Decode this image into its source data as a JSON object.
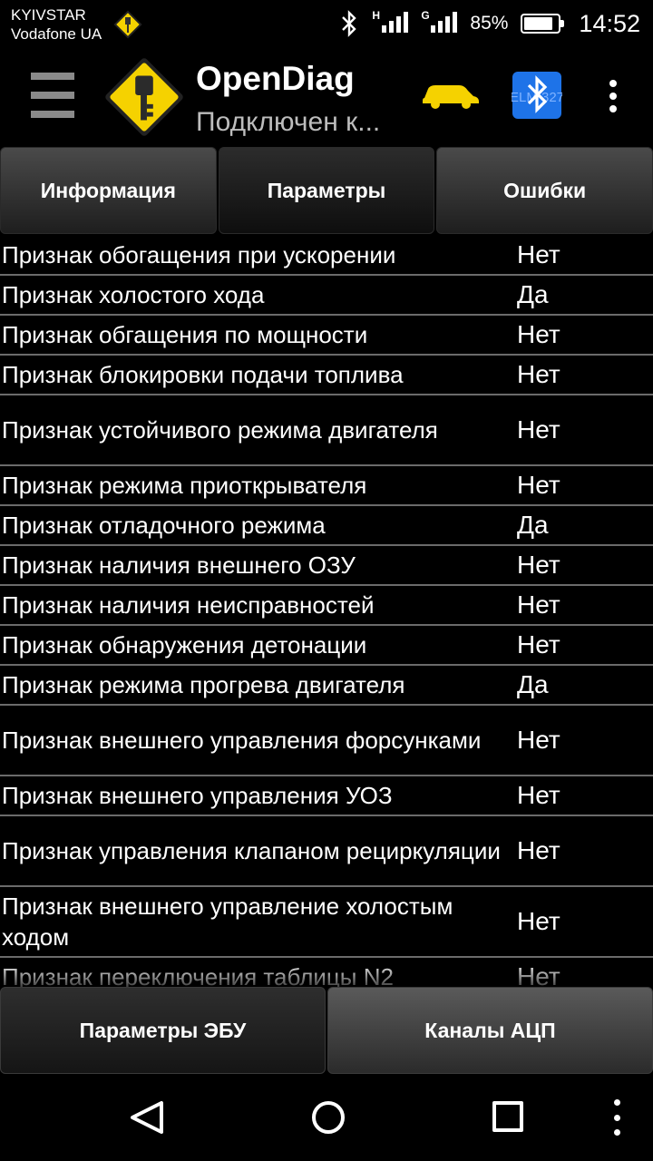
{
  "status_bar": {
    "carrier_1": "KYIVSTAR",
    "carrier_2": "Vodafone UA",
    "signal_1_label": "H",
    "signal_2_label": "G",
    "battery_percent": "85%",
    "battery_level": 0.85,
    "time": "14:52"
  },
  "app_bar": {
    "title": "OpenDiag",
    "subtitle": "Подключен к...",
    "bt_label": "ELM 327",
    "car_color": "#f5d200",
    "bt_color": "#1e73e8"
  },
  "tabs": [
    {
      "label": "Информация",
      "active": false
    },
    {
      "label": "Параметры",
      "active": true
    },
    {
      "label": "Ошибки",
      "active": false
    }
  ],
  "parameters": [
    {
      "name": "Признак обогащения при ускорении",
      "value": "Нет"
    },
    {
      "name": "Признак холостого хода",
      "value": "Да"
    },
    {
      "name": "Признак обгащения по мощности",
      "value": "Нет"
    },
    {
      "name": "Признак блокировки подачи топлива",
      "value": "Нет"
    },
    {
      "name": "Признак устойчивого режима двигателя",
      "value": "Нет"
    },
    {
      "name": "Признак режима приоткрывателя",
      "value": "Нет"
    },
    {
      "name": "Признак отладочного режима",
      "value": "Да"
    },
    {
      "name": "Признак наличия внешнего ОЗУ",
      "value": "Нет"
    },
    {
      "name": "Признак наличия неисправностей",
      "value": "Нет"
    },
    {
      "name": "Признак обнаружения детонации",
      "value": "Нет"
    },
    {
      "name": "Признак режима прогрева двигателя",
      "value": "Да"
    },
    {
      "name": "Признак внешнего управления форсунками",
      "value": "Нет"
    },
    {
      "name": "Признак внешнего управления УОЗ",
      "value": "Нет"
    },
    {
      "name": "Признак управления клапаном рециркуляции",
      "value": "Нет"
    },
    {
      "name": "Признак внешнего управление холостым ходом",
      "value": "Нет"
    },
    {
      "name": "Признак переключения таблицы N2",
      "value": "Нет"
    }
  ],
  "bottom_buttons": {
    "ecu_params": "Параметры ЭБУ",
    "adc_channels": "Каналы АЦП"
  },
  "icons": {
    "menu": "hamburger-icon",
    "logo": "key-warning-sign-icon",
    "car": "car-icon",
    "bluetooth": "bluetooth-elm-icon",
    "overflow": "overflow-menu-icon",
    "back": "back-icon",
    "home": "home-icon",
    "recent": "recent-apps-icon"
  }
}
